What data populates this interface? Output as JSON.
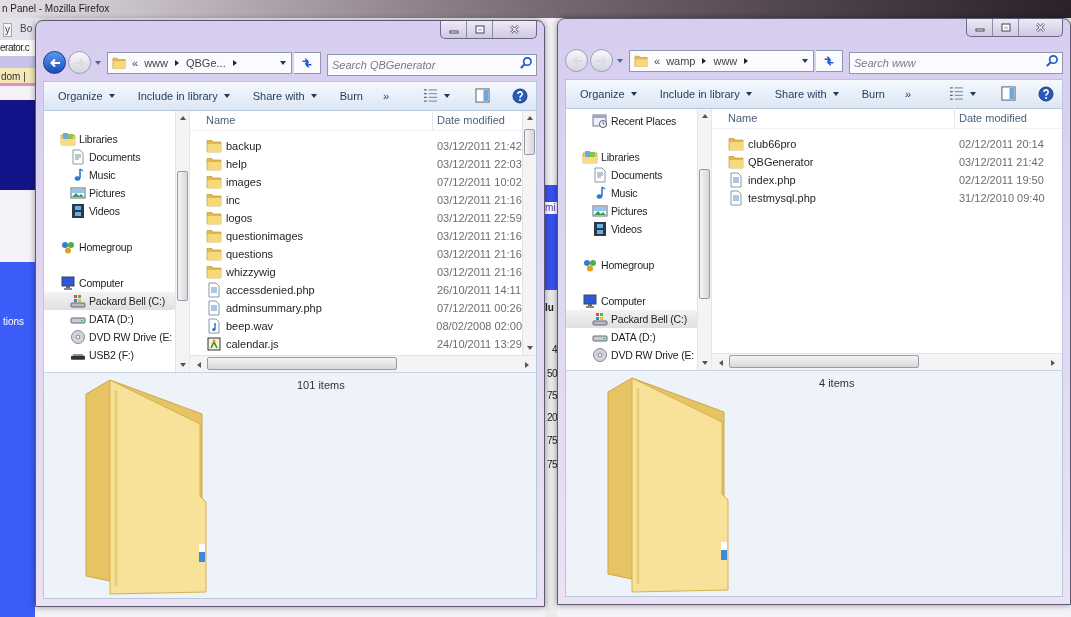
{
  "background_browser": {
    "title": "n Panel - Mozilla Firefox",
    "toolbar_fragments": [
      "y",
      "Bo"
    ],
    "url_fragment": "erator.c",
    "link_fragment": "dom |",
    "sidebar_fragment": "tions",
    "heading_fragment": "mi",
    "column_fragment": "lu",
    "cells": [
      "4",
      "50",
      "75",
      "20",
      "75",
      "75"
    ]
  },
  "windows": [
    {
      "back_enabled": true,
      "forward_enabled": false,
      "address": {
        "overflow": "«",
        "crumbs": [
          "www",
          "QBGe..."
        ]
      },
      "search": {
        "placeholder": "Search QBGenerator"
      },
      "toolbar": [
        {
          "label": "Organize",
          "has_menu": true
        },
        {
          "label": "Include in library",
          "has_menu": true
        },
        {
          "label": "Share with",
          "has_menu": true
        },
        {
          "label": "Burn",
          "has_menu": false
        }
      ],
      "toolbar_overflow": "»",
      "nav": [
        {
          "label": "Libraries",
          "kind": "library",
          "selected": false,
          "children": [
            {
              "label": "Documents",
              "kind": "documents",
              "selected": false
            },
            {
              "label": "Music",
              "kind": "music",
              "selected": false
            },
            {
              "label": "Pictures",
              "kind": "pictures",
              "selected": false
            },
            {
              "label": "Videos",
              "kind": "videos",
              "selected": false
            }
          ]
        },
        {
          "label": "Homegroup",
          "kind": "homegroup",
          "selected": false
        },
        {
          "label": "Computer",
          "kind": "computer",
          "selected": false,
          "children": [
            {
              "label": "Packard Bell (C:)",
              "kind": "system-drive",
              "selected": true
            },
            {
              "label": "DATA (D:)",
              "kind": "drive",
              "selected": false
            },
            {
              "label": "DVD RW Drive (E:",
              "kind": "dvd",
              "selected": false
            },
            {
              "label": "USB2 (F:)",
              "kind": "usb",
              "selected": false
            }
          ]
        }
      ],
      "columns": [
        "Name",
        "Date modified"
      ],
      "files": [
        {
          "name": "backup",
          "date": "03/12/2011 21:42",
          "kind": "folder"
        },
        {
          "name": "help",
          "date": "03/12/2011 22:03",
          "kind": "folder"
        },
        {
          "name": "images",
          "date": "07/12/2011 10:02",
          "kind": "folder"
        },
        {
          "name": "inc",
          "date": "03/12/2011 21:16",
          "kind": "folder"
        },
        {
          "name": "logos",
          "date": "03/12/2011 22:59",
          "kind": "folder"
        },
        {
          "name": "questionimages",
          "date": "03/12/2011 21:16",
          "kind": "folder"
        },
        {
          "name": "questions",
          "date": "03/12/2011 21:16",
          "kind": "folder"
        },
        {
          "name": "whizzywig",
          "date": "03/12/2011 21:16",
          "kind": "folder"
        },
        {
          "name": "accessdenied.php",
          "date": "26/10/2011 14:11",
          "kind": "php"
        },
        {
          "name": "adminsummary.php",
          "date": "07/12/2011 00:26",
          "kind": "php"
        },
        {
          "name": "beep.wav",
          "date": "08/02/2008 02:00",
          "kind": "wav"
        },
        {
          "name": "calendar.js",
          "date": "24/10/2011 13:29",
          "kind": "js"
        }
      ],
      "status": "101 items"
    },
    {
      "back_enabled": false,
      "forward_enabled": false,
      "address": {
        "overflow": "«",
        "crumbs": [
          "wamp",
          "www"
        ]
      },
      "search": {
        "placeholder": "Search www"
      },
      "toolbar": [
        {
          "label": "Organize",
          "has_menu": true
        },
        {
          "label": "Include in library",
          "has_menu": true
        },
        {
          "label": "Share with",
          "has_menu": true
        },
        {
          "label": "Burn",
          "has_menu": false
        }
      ],
      "toolbar_overflow": "»",
      "nav": [
        {
          "children": [
            {
              "label": "Recent Places",
              "kind": "recent",
              "selected": false
            }
          ]
        },
        {
          "label": "Libraries",
          "kind": "library",
          "selected": false,
          "children": [
            {
              "label": "Documents",
              "kind": "documents",
              "selected": false
            },
            {
              "label": "Music",
              "kind": "music",
              "selected": false
            },
            {
              "label": "Pictures",
              "kind": "pictures",
              "selected": false
            },
            {
              "label": "Videos",
              "kind": "videos",
              "selected": false
            }
          ]
        },
        {
          "label": "Homegroup",
          "kind": "homegroup",
          "selected": false
        },
        {
          "label": "Computer",
          "kind": "computer",
          "selected": false,
          "children": [
            {
              "label": "Packard Bell (C:)",
              "kind": "system-drive",
              "selected": true
            },
            {
              "label": "DATA (D:)",
              "kind": "drive",
              "selected": false
            },
            {
              "label": "DVD RW Drive (E:",
              "kind": "dvd",
              "selected": false
            }
          ]
        }
      ],
      "columns": [
        "Name",
        "Date modified"
      ],
      "files": [
        {
          "name": "club66pro",
          "date": "02/12/2011 20:14",
          "kind": "folder"
        },
        {
          "name": "QBGenerator",
          "date": "03/12/2011 21:42",
          "kind": "folder"
        },
        {
          "name": "index.php",
          "date": "02/12/2011 19:50",
          "kind": "php"
        },
        {
          "name": "testmysql.php",
          "date": "31/12/2010 09:40",
          "kind": "php"
        }
      ],
      "status": "4 items"
    }
  ]
}
